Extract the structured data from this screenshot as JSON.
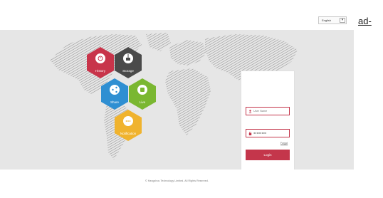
{
  "header": {
    "language_label": "English"
  },
  "tiles": [
    {
      "label": "History",
      "icon": "history-icon",
      "color": "#c8344a"
    },
    {
      "label": "Storage",
      "icon": "storage-icon",
      "color": "#4a4a4a"
    },
    {
      "label": "Share",
      "icon": "share-icon",
      "color": "#2f8fd2"
    },
    {
      "label": "Live",
      "icon": "live-icon",
      "color": "#7ab731"
    },
    {
      "label": "Notification",
      "icon": "notification-icon",
      "color": "#f0b32e"
    }
  ],
  "login": {
    "username_placeholder": "User Name",
    "password_value": "●●●●●●●●",
    "forgot_label": "Forgot",
    "login_button": "Login",
    "accent_color": "#c4364b"
  },
  "footer": {
    "copyright": "© Hangzhou Technology Limited. All Rights Reserved."
  },
  "side": {
    "link_text": "ad-"
  }
}
